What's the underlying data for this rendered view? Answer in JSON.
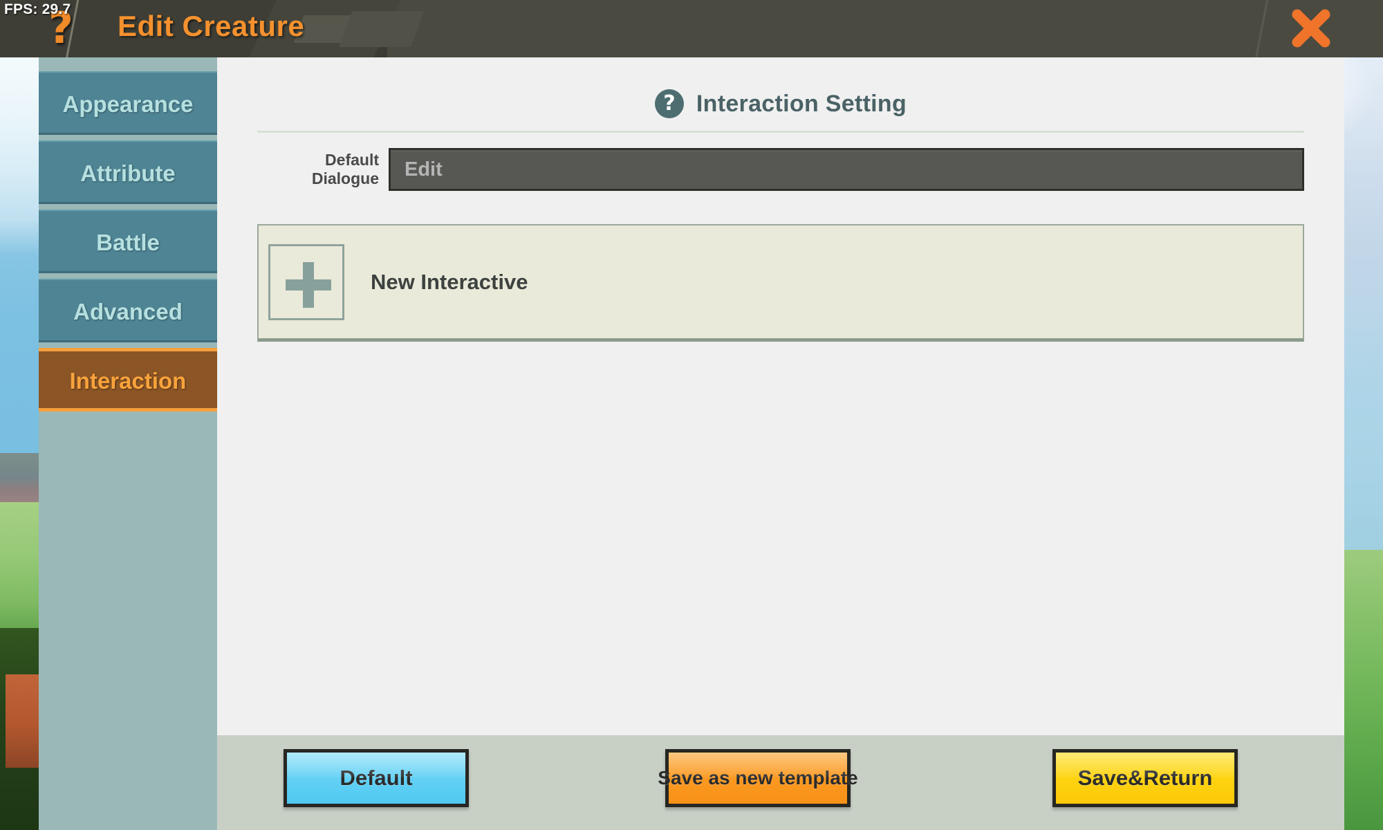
{
  "hud": {
    "fps_label": "FPS: 29.7",
    "help_glyph": "?"
  },
  "titlebar": {
    "title": "Edit Creature",
    "close_icon": "close-icon",
    "accent_color": "#f5912e",
    "background_color": "#3b3b34"
  },
  "sidebar": {
    "items": [
      {
        "label": "Appearance",
        "active": false
      },
      {
        "label": "Attribute",
        "active": false
      },
      {
        "label": "Battle",
        "active": false
      },
      {
        "label": "Advanced",
        "active": false
      },
      {
        "label": "Interaction",
        "active": true
      }
    ],
    "active_color": "#f9a33c",
    "tab_color": "#4e8494"
  },
  "panel": {
    "help_glyph": "?",
    "title": "Interaction Setting",
    "dialogue": {
      "label": "Default Dialogue",
      "value": "Edit"
    },
    "interactive": {
      "plus_icon": "plus-icon",
      "label": "New Interactive"
    }
  },
  "footer": {
    "buttons": [
      {
        "label": "Default",
        "color": "#5fd0f4"
      },
      {
        "label": "Save as new template",
        "color": "#fb9a22"
      },
      {
        "label": "Save&Return",
        "color": "#fed412"
      }
    ]
  }
}
